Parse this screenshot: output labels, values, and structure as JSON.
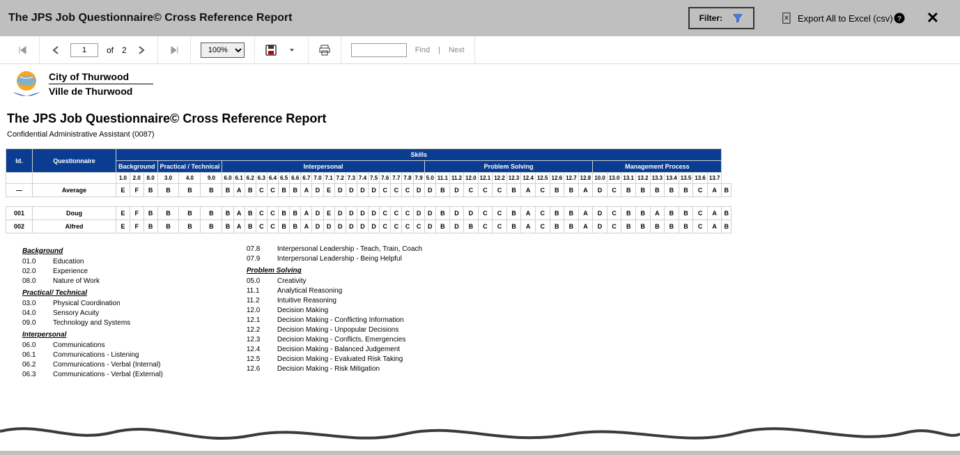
{
  "header": {
    "title": "The JPS Job Questionnaire© Cross Reference Report",
    "filter_label": "Filter:",
    "export_label": "Export All to Excel (csv)",
    "help_icon": "?",
    "close_icon": "✕"
  },
  "toolbar": {
    "page_current": "1",
    "page_of": "of",
    "page_total": "2",
    "zoom": "100%",
    "find": "Find",
    "next": "Next"
  },
  "org": {
    "en": "City of Thurwood",
    "fr": "Ville de Thurwood"
  },
  "report": {
    "title": "The JPS Job Questionnaire© Cross Reference Report",
    "subtitle": "Confidential Administrative Assistant (0087)"
  },
  "table": {
    "top": {
      "skills": "Skills"
    },
    "head": {
      "id": "Id.",
      "quest": "Questionnaire",
      "bg": "Background",
      "pt": "Practical / Technical",
      "ip": "Interpersonal",
      "ps": "Problem  Solving",
      "mp": "Management Process"
    },
    "cols": [
      "1.0",
      "2.0",
      "8.0",
      "3.0",
      "4.0",
      "9.0",
      "6.0",
      "6.1",
      "6.2",
      "6.3",
      "6.4",
      "6.5",
      "6.6",
      "6.7",
      "7.0",
      "7.1",
      "7.2",
      "7.3",
      "7.4",
      "7.5",
      "7.6",
      "7.7",
      "7.8",
      "7.9",
      "5.0",
      "11.1",
      "11.2",
      "12.0",
      "12.1",
      "12.2",
      "12.3",
      "12.4",
      "12.5",
      "12.6",
      "12.7",
      "12.8",
      "10.0",
      "13.0",
      "13.1",
      "13.2",
      "13.3",
      "13.4",
      "13.5",
      "13.6",
      "13.7"
    ],
    "rows": [
      {
        "id": "—",
        "name": "Average",
        "v": [
          "E",
          "F",
          "B",
          "B",
          "B",
          "B",
          "B",
          "A",
          "B",
          "C",
          "C",
          "B",
          "B",
          "A",
          "D",
          "E",
          "D",
          "D",
          "D",
          "D",
          "C",
          "C",
          "C",
          "D",
          "D",
          "B",
          "D",
          "C",
          "C",
          "C",
          "B",
          "A",
          "C",
          "B",
          "B",
          "A",
          "D",
          "C",
          "B",
          "B",
          "B",
          "B",
          "B",
          "C",
          "A",
          "B"
        ]
      },
      {
        "id": "001",
        "name": "Doug",
        "v": [
          "E",
          "F",
          "B",
          "B",
          "B",
          "B",
          "B",
          "A",
          "B",
          "C",
          "C",
          "B",
          "B",
          "A",
          "D",
          "E",
          "D",
          "D",
          "D",
          "D",
          "C",
          "C",
          "C",
          "D",
          "D",
          "B",
          "D",
          "D",
          "C",
          "C",
          "B",
          "A",
          "C",
          "B",
          "B",
          "A",
          "D",
          "C",
          "B",
          "B",
          "A",
          "B",
          "B",
          "C",
          "A",
          "B"
        ]
      },
      {
        "id": "002",
        "name": "Alfred",
        "v": [
          "E",
          "F",
          "B",
          "B",
          "B",
          "B",
          "B",
          "A",
          "B",
          "C",
          "C",
          "B",
          "B",
          "A",
          "D",
          "D",
          "D",
          "D",
          "D",
          "D",
          "C",
          "C",
          "C",
          "C",
          "D",
          "B",
          "D",
          "B",
          "C",
          "C",
          "B",
          "A",
          "C",
          "B",
          "B",
          "A",
          "D",
          "C",
          "B",
          "B",
          "B",
          "B",
          "B",
          "C",
          "A",
          "B"
        ]
      }
    ]
  },
  "legend": {
    "left": {
      "h1": "Background",
      "items1": [
        [
          "01.0",
          "Education"
        ],
        [
          "02.0",
          "Experience"
        ],
        [
          "08.0",
          "Nature of Work"
        ]
      ],
      "h2": "Practical/ Technical",
      "items2": [
        [
          "03.0",
          "Physical Coordination"
        ],
        [
          "04.0",
          "Sensory Acuity"
        ],
        [
          "09.0",
          "Technology and Systems"
        ]
      ],
      "h3": "Interpersonal",
      "items3": [
        [
          "06.0",
          "Communications"
        ],
        [
          "06.1",
          "Communications - Listening"
        ],
        [
          "06.2",
          "Communications - Verbal (Internal)"
        ],
        [
          "06.3",
          "Communications - Verbal (External)"
        ]
      ]
    },
    "right": {
      "pre": [
        [
          "07.8",
          "Interpersonal Leadership - Teach, Train, Coach"
        ],
        [
          "07.9",
          "Interpersonal Leadership - Being Helpful"
        ]
      ],
      "h1": "Problem Solving",
      "items1": [
        [
          "05.0",
          "Creativity"
        ],
        [
          "11.1",
          "Analytical Reasoning"
        ],
        [
          "11.2",
          "Intuitive Reasoning"
        ],
        [
          "12.0",
          "Decision Making"
        ],
        [
          "12.1",
          "Decision Making - Conflicting Information"
        ],
        [
          "12.2",
          "Decision Making - Unpopular Decisions"
        ],
        [
          "12.3",
          "Decision Making - Conflicts, Emergencies"
        ],
        [
          "12.4",
          "Decision Making - Balanced Judgement"
        ],
        [
          "12.5",
          "Decision Making - Evaluated Risk Taking"
        ],
        [
          "12.6",
          "Decision Making - Risk Mitigation"
        ]
      ]
    }
  }
}
